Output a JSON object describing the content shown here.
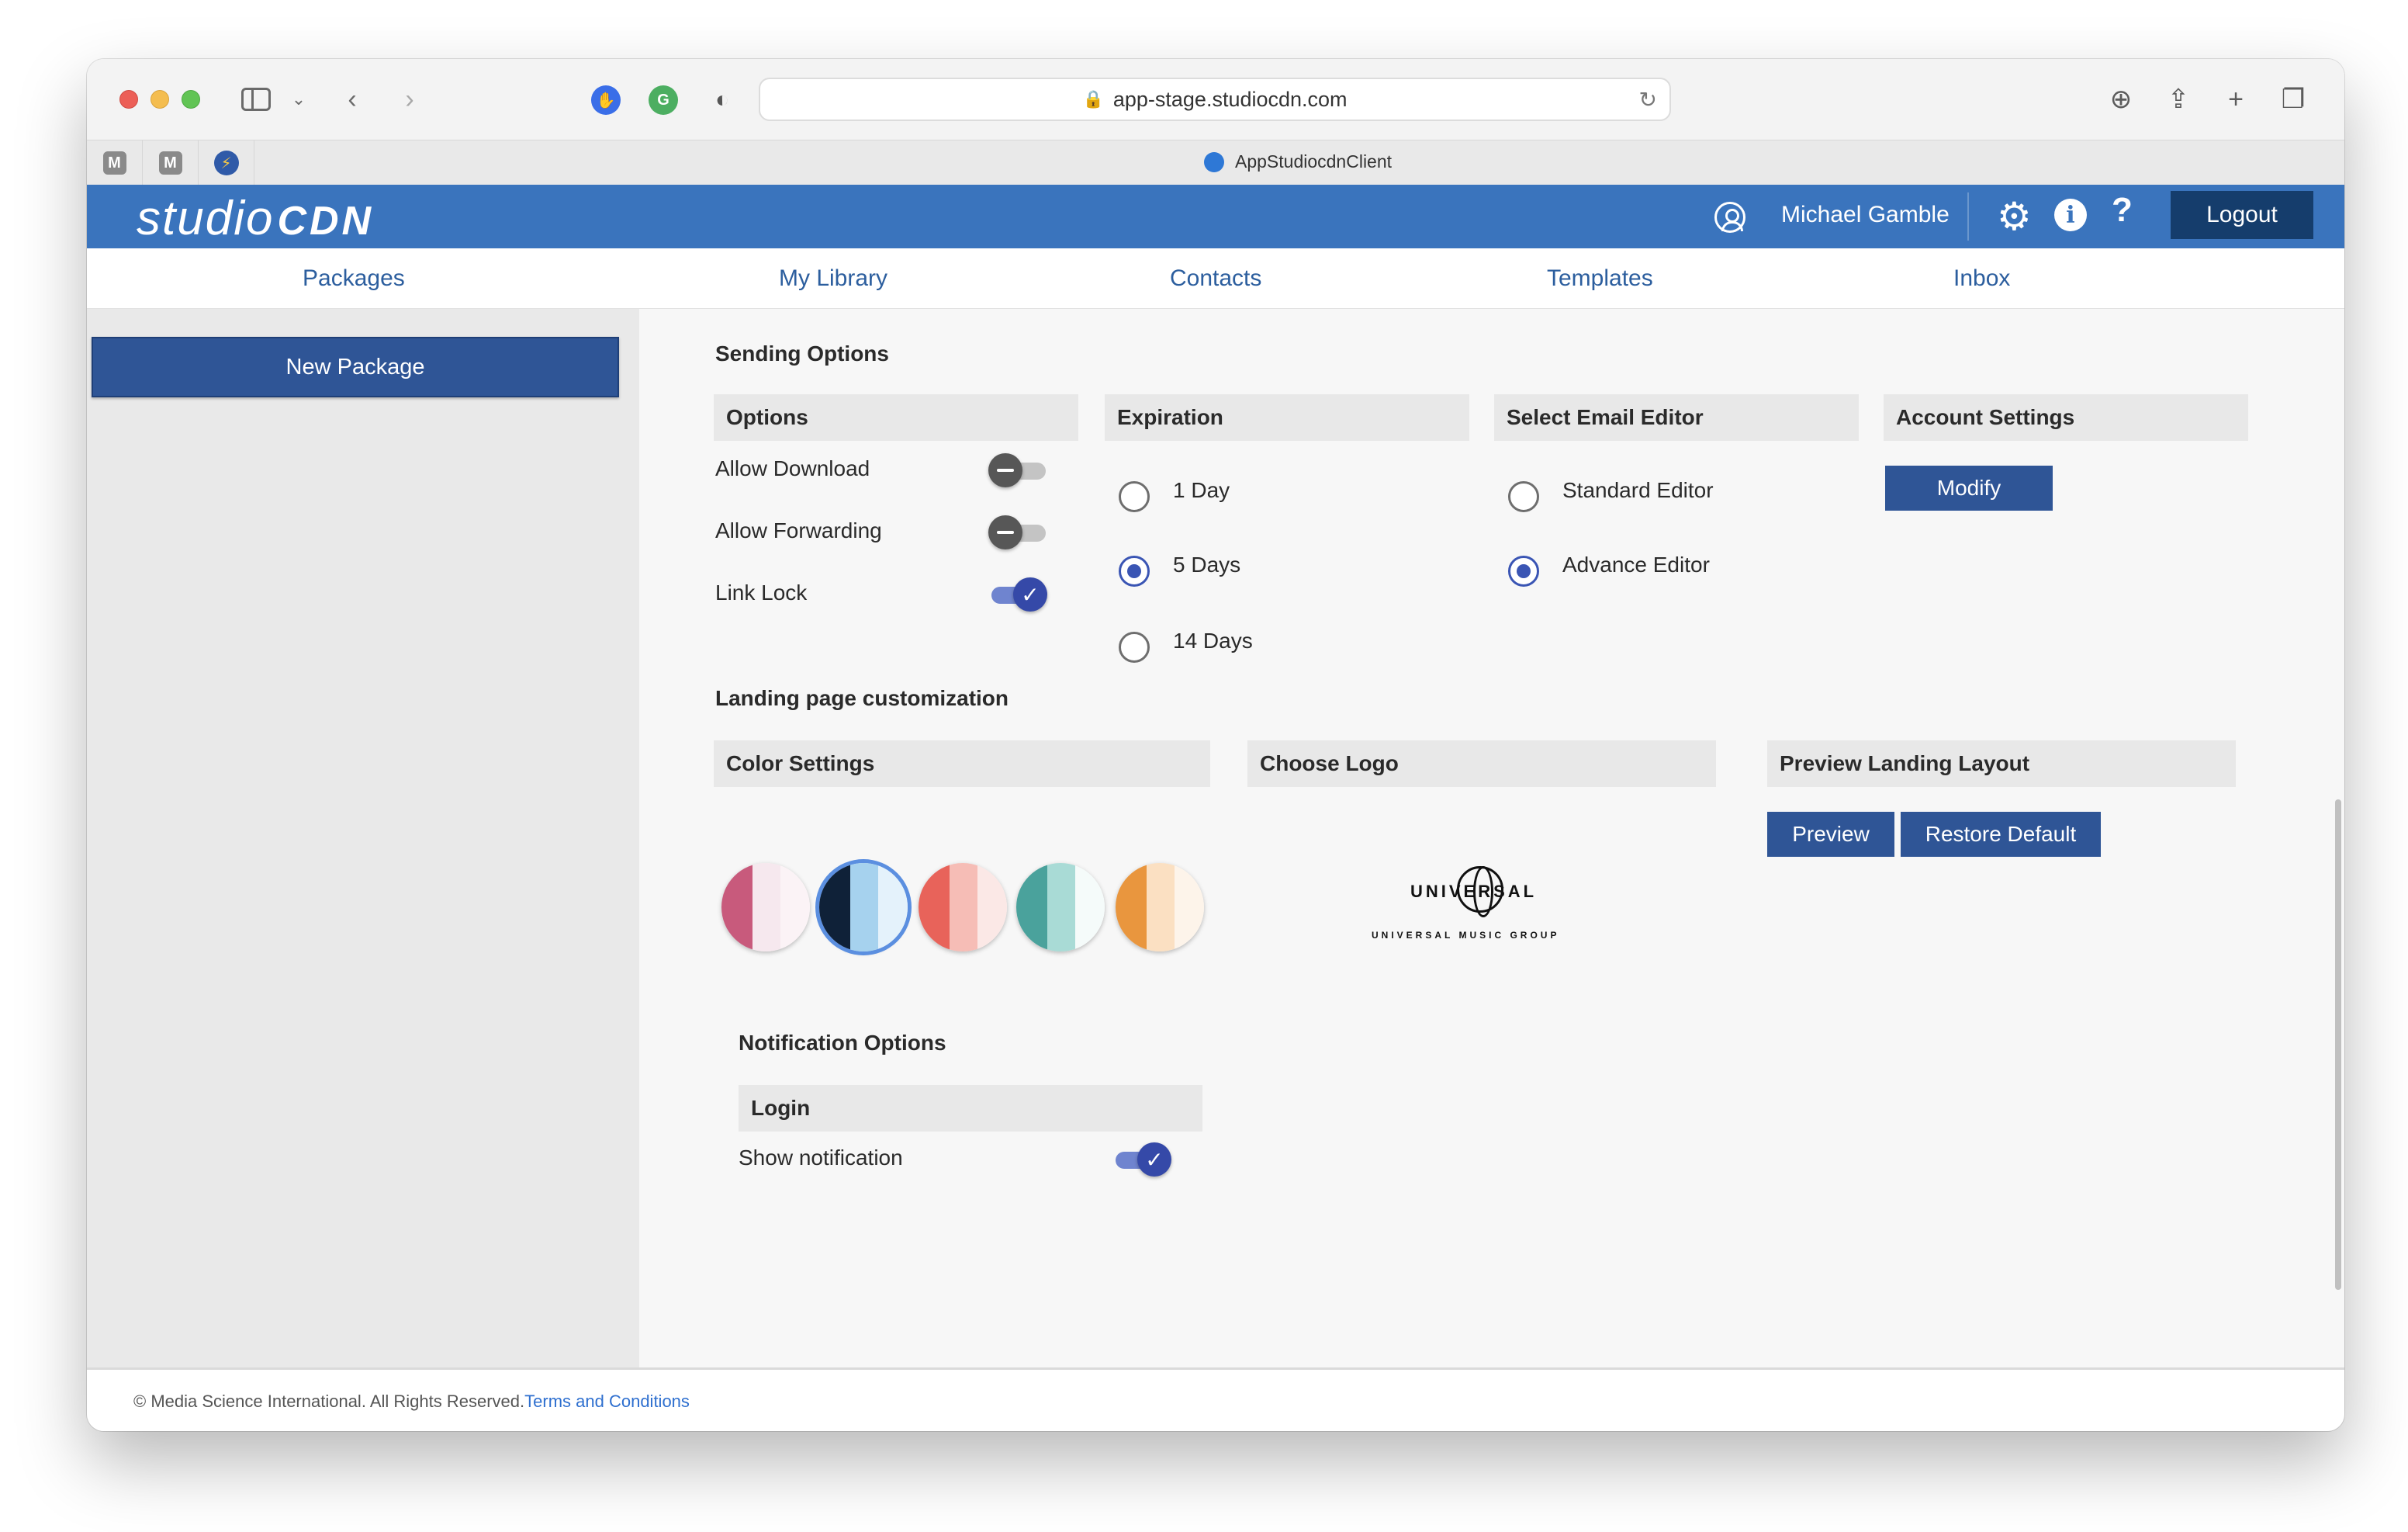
{
  "browser": {
    "url": "app-stage.studiocdn.com",
    "tab_title": "AppStudiocdnClient",
    "pinned_tabs": [
      "M",
      "M"
    ]
  },
  "header": {
    "logo_left": "studio",
    "logo_right": "CDN",
    "username": "Michael Gamble",
    "help": "?",
    "logout": "Logout"
  },
  "nav": {
    "items": [
      "Packages",
      "My Library",
      "Contacts",
      "Templates",
      "Inbox"
    ]
  },
  "sidebar": {
    "new_package": "New Package"
  },
  "sending_options": {
    "title": "Sending Options",
    "options": {
      "header": "Options",
      "items": [
        {
          "label": "Allow Download",
          "enabled": false
        },
        {
          "label": "Allow Forwarding",
          "enabled": false
        },
        {
          "label": "Link Lock",
          "enabled": true
        }
      ]
    },
    "expiration": {
      "header": "Expiration",
      "choices": [
        "1 Day",
        "5 Days",
        "14 Days"
      ],
      "selected": "5 Days"
    },
    "email_editor": {
      "header": "Select Email Editor",
      "choices": [
        "Standard Editor",
        "Advance Editor"
      ],
      "selected": "Advance Editor"
    },
    "account_settings": {
      "header": "Account Settings",
      "modify": "Modify"
    }
  },
  "landing": {
    "title": "Landing page customization",
    "color_settings": {
      "header": "Color Settings",
      "swatches": [
        {
          "colors": [
            "#c85a7c",
            "#f6e8ee",
            "#fbf3f6"
          ],
          "selected": false
        },
        {
          "colors": [
            "#0f2138",
            "#a6d2ee",
            "#e4f2fb"
          ],
          "selected": true
        },
        {
          "colors": [
            "#e8635a",
            "#f6bdb6",
            "#fbe8e6"
          ],
          "selected": false
        },
        {
          "colors": [
            "#4aa29c",
            "#a9dbd6",
            "#f5fbfa"
          ],
          "selected": false
        },
        {
          "colors": [
            "#e9963e",
            "#fbe0c2",
            "#fdf4ea"
          ],
          "selected": false
        }
      ]
    },
    "choose_logo": {
      "header": "Choose Logo",
      "logo_word": "UNIVERSAL",
      "logo_sub": "UNIVERSAL MUSIC GROUP"
    },
    "preview_layout": {
      "header": "Preview Landing Layout",
      "preview": "Preview",
      "restore": "Restore Default"
    }
  },
  "notification": {
    "title": "Notification Options",
    "header": "Login",
    "items": [
      {
        "label": "Show notification",
        "enabled": true
      }
    ]
  },
  "footer": {
    "copyright": "© Media Science International. All Rights Reserved.",
    "terms": "Terms and Conditions"
  }
}
